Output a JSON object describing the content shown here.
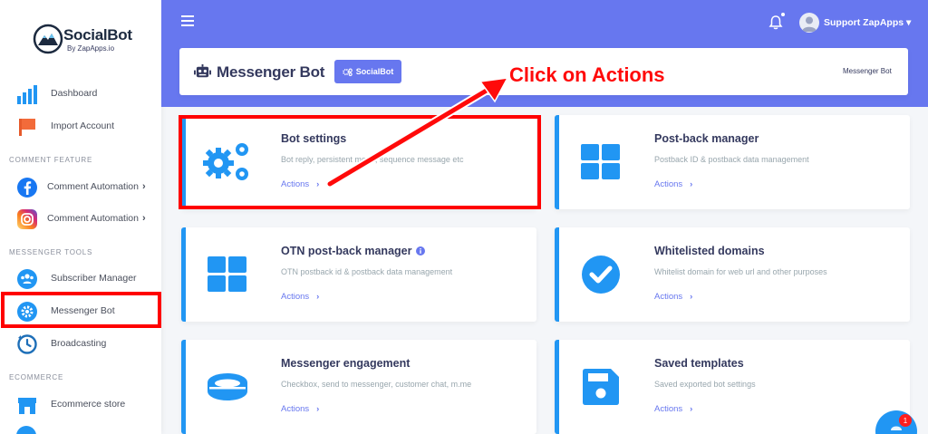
{
  "brand": {
    "name": "SocialBot",
    "tagline": "By ZapApps.io"
  },
  "sidebar": {
    "items": [
      {
        "label": "Dashboard",
        "icon": "bar-chart-icon"
      },
      {
        "label": "Import Account",
        "icon": "flag-icon"
      },
      {
        "label": "Comment Automation",
        "icon": "facebook-icon"
      },
      {
        "label": "Comment Automation",
        "icon": "instagram-icon"
      },
      {
        "label": "Subscriber Manager",
        "icon": "users-icon"
      },
      {
        "label": "Messenger Bot",
        "icon": "gear-icon"
      },
      {
        "label": "Broadcasting",
        "icon": "clock-icon"
      },
      {
        "label": "Ecommerce store",
        "icon": "store-icon"
      }
    ],
    "headers": {
      "comment": "COMMENT FEATURE",
      "messenger": "MESSENGER TOOLS",
      "ecommerce": "ECOMMERCE"
    }
  },
  "topbar": {
    "user_name": "Support ZapApps ▾"
  },
  "page_header": {
    "title": "Messenger Bot",
    "button_label": "SocialBot",
    "breadcrumb": "Messenger Bot"
  },
  "annotation": {
    "text": "Click on Actions"
  },
  "cards": [
    {
      "title": "Bot settings",
      "desc": "Bot reply, persistent menu, sequence message etc",
      "action": "Actions"
    },
    {
      "title": "Post-back manager",
      "desc": "Postback ID & postback data management",
      "action": "Actions"
    },
    {
      "title": "OTN post-back manager",
      "desc": "OTN postback id & postback data management",
      "action": "Actions"
    },
    {
      "title": "Whitelisted domains",
      "desc": "Whitelist domain for web url and other purposes",
      "action": "Actions"
    },
    {
      "title": "Messenger engagement",
      "desc": "Checkbox, send to messenger, customer chat, m.me",
      "action": "Actions"
    },
    {
      "title": "Saved templates",
      "desc": "Saved exported bot settings",
      "action": "Actions"
    }
  ],
  "chat": {
    "badge": "1"
  },
  "colors": {
    "accent": "#6777ef",
    "card_border": "#2196f3",
    "highlight": "#ff0000"
  }
}
